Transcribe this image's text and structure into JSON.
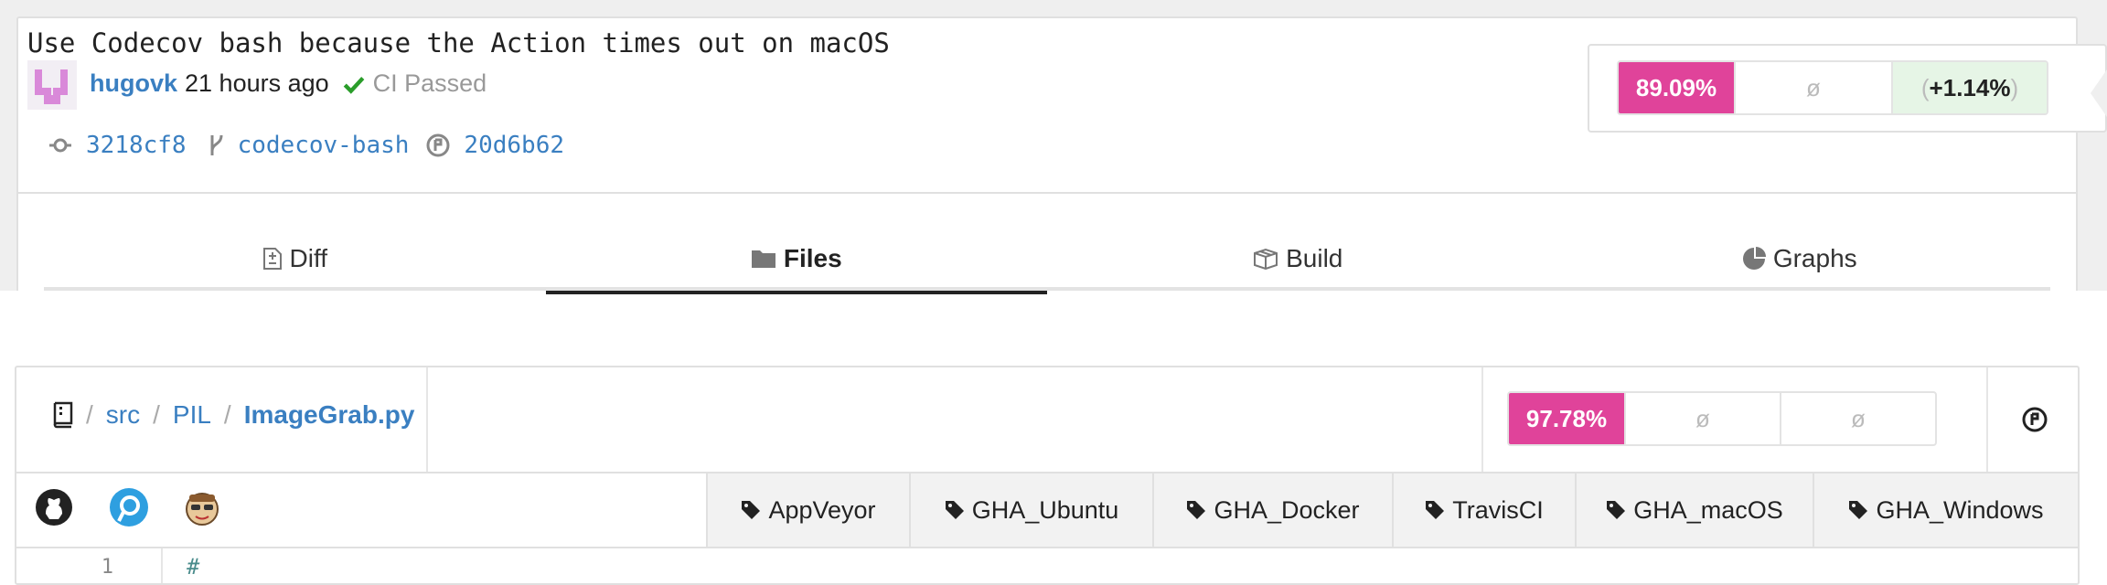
{
  "commit": {
    "message": "Use Codecov bash because the Action times out on macOS",
    "author": "hugovk",
    "time_ago": "21 hours ago",
    "ci_status": "CI Passed",
    "sha": "3218cf8",
    "branch": "codecov-bash",
    "parent": "20d6b62"
  },
  "coverage": {
    "head": "89.09%",
    "patch": "ø",
    "change_open": "(",
    "change": "+1.14%",
    "change_close": ")"
  },
  "tabs": [
    {
      "label": "Diff",
      "icon": "diff-icon"
    },
    {
      "label": "Files",
      "icon": "folder-icon",
      "active": true
    },
    {
      "label": "Build",
      "icon": "box-icon"
    },
    {
      "label": "Graphs",
      "icon": "pie-chart-icon"
    }
  ],
  "file": {
    "crumbs": [
      "src",
      "PIL",
      "ImageGrab.py"
    ],
    "separator": "/",
    "coverage": "97.78%",
    "patch": "ø",
    "change": "ø"
  },
  "integrations": [
    "github-icon",
    "appveyor-icon",
    "travis-icon"
  ],
  "flags": [
    "AppVeyor",
    "GHA_Ubuntu",
    "GHA_Docker",
    "TravisCI",
    "GHA_macOS",
    "GHA_Windows"
  ],
  "code_lines": [
    {
      "number": "1",
      "text": "#"
    }
  ],
  "colors": {
    "accent": "#e0439a",
    "link": "#3a7fc1",
    "positive_bg": "#e6f5e6",
    "ci_pass": "#2a9d2a"
  }
}
